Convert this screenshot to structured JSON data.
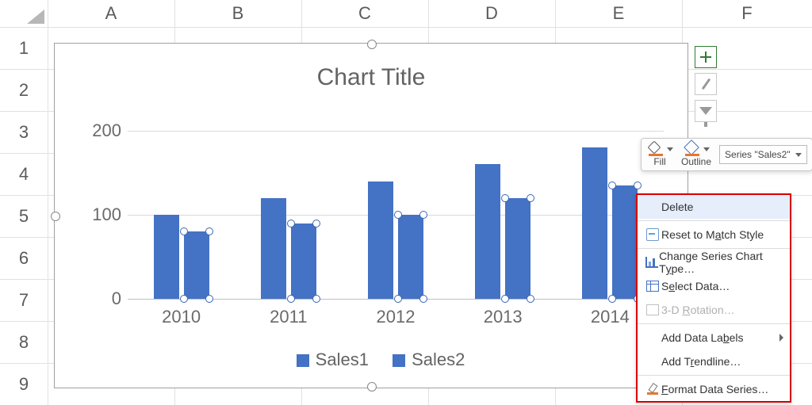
{
  "grid": {
    "columns": [
      "A",
      "B",
      "C",
      "D",
      "E",
      "F"
    ],
    "rows": [
      "1",
      "2",
      "3",
      "4",
      "5",
      "6",
      "7",
      "8",
      "9"
    ]
  },
  "chart": {
    "title": "Chart Title",
    "legend": {
      "series1": "Sales1",
      "series2": "Sales2"
    }
  },
  "chart_data": {
    "type": "bar",
    "title": "Chart Title",
    "xlabel": "",
    "ylabel": "",
    "ylim": [
      0,
      200
    ],
    "yticks": [
      0,
      100,
      200
    ],
    "categories": [
      "2010",
      "2011",
      "2012",
      "2013",
      "2014"
    ],
    "series": [
      {
        "name": "Sales1",
        "values": [
          100,
          120,
          140,
          160,
          180
        ]
      },
      {
        "name": "Sales2",
        "values": [
          80,
          90,
          100,
          120,
          135
        ]
      }
    ],
    "selected_series": "Sales2"
  },
  "side_buttons": {
    "add_element_tooltip": "Chart Elements",
    "styles_tooltip": "Chart Styles",
    "filter_tooltip": "Chart Filters"
  },
  "mini_toolbar": {
    "fill": "Fill",
    "outline": "Outline",
    "series_selector": "Series \"Sales2\""
  },
  "context_menu": {
    "delete": "Delete",
    "reset": "Reset to Match Style",
    "change_type": "Change Series Chart Type…",
    "select_data": "Select Data…",
    "rotation": "3-D Rotation…",
    "add_labels": "Add Data Labels",
    "add_trendline": "Add Trendline…",
    "format_series": "Format Data Series…",
    "hotkeys": {
      "reset": "A",
      "change_type": "Y",
      "select_data": "e",
      "rotation": "R",
      "add_labels": "B",
      "add_trendline": "R",
      "format_series": "F"
    }
  }
}
